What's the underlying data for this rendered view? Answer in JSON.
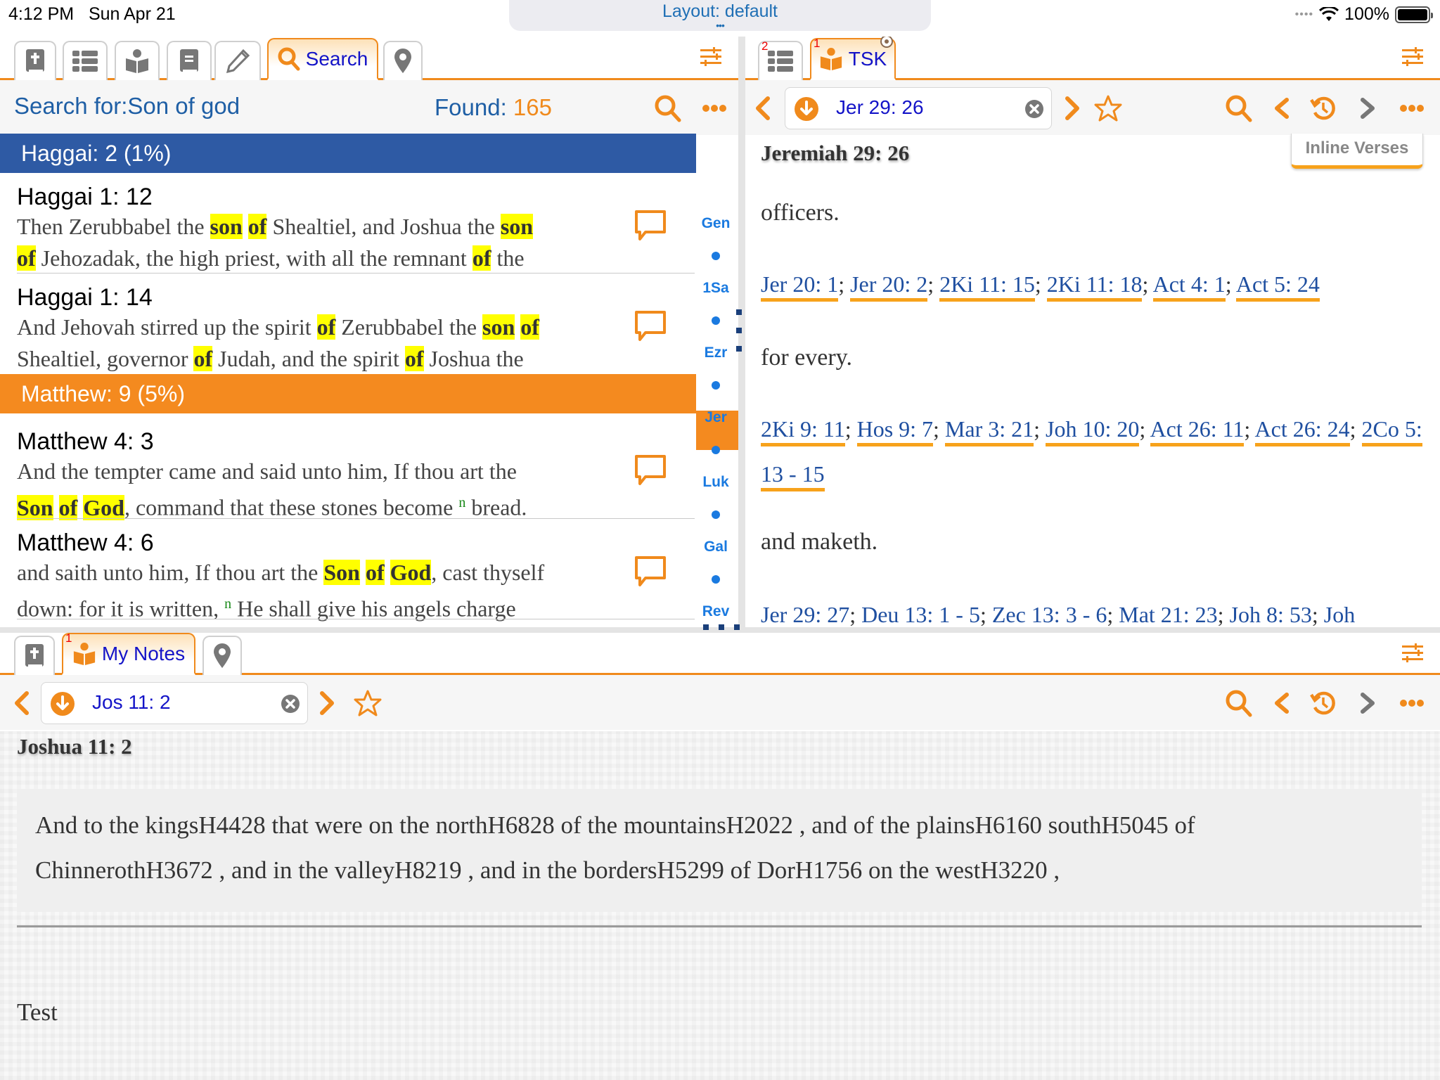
{
  "status_bar": {
    "time": "4:12 PM",
    "date": "Sun Apr 21",
    "battery": "100%",
    "battery_level": 1.0
  },
  "layout_pill": {
    "label": "Layout: default",
    "more": "•••"
  },
  "left_pane": {
    "tabs": [
      {
        "icon": "bible-icon",
        "label": ""
      },
      {
        "icon": "list-icon",
        "label": ""
      },
      {
        "icon": "reader-icon",
        "label": ""
      },
      {
        "icon": "book-icon",
        "label": ""
      },
      {
        "icon": "pencil-icon",
        "label": ""
      },
      {
        "icon": "search-icon",
        "label": "Search",
        "active": true
      },
      {
        "icon": "map-pin-icon",
        "label": ""
      }
    ],
    "search_for": "Search for:Son of god",
    "found_label": "Found:",
    "found_count": "165",
    "groups": [
      {
        "title": "Haggai: 2 (1%)",
        "color": "#2e5aa4",
        "items": [
          {
            "ref": "Haggai 1: 12",
            "line1": [
              "Then Zerubbabel the ",
              {
                "hl": "son"
              },
              " ",
              {
                "hl": "of"
              },
              " Shealtiel, and Joshua the ",
              {
                "hl": "son"
              }
            ],
            "line2": [
              {
                "hl": "of"
              },
              " Jehozadak, the high priest, with all the remnant ",
              {
                "hl": "of"
              },
              " the"
            ]
          },
          {
            "ref": "Haggai 1: 14",
            "line1": [
              "And Jehovah stirred up the spirit ",
              {
                "hl": "of"
              },
              " Zerubbabel the ",
              {
                "hl": "son"
              },
              " ",
              {
                "hl": "of"
              }
            ],
            "line2": [
              "Shealtiel, governor ",
              {
                "hl": "of"
              },
              " Judah, and the spirit ",
              {
                "hl": "of"
              },
              " Joshua the"
            ]
          }
        ]
      },
      {
        "title": "Matthew: 9 (5%)",
        "color": "#f48a1f",
        "items": [
          {
            "ref": "Matthew 4: 3",
            "line1": [
              "And the tempter came and said unto him, If thou art the"
            ],
            "line2": [
              {
                "hl": "Son"
              },
              " ",
              {
                "hl": "of"
              },
              " ",
              {
                "hl": "God"
              },
              ", command that these stones become ",
              {
                "sup": "n"
              },
              " bread."
            ]
          },
          {
            "ref": "Matthew 4: 6",
            "line1": [
              "and saith unto him, If thou art the ",
              {
                "hl": "Son"
              },
              " ",
              {
                "hl": "of"
              },
              " ",
              {
                "hl": "God"
              },
              ", cast thyself"
            ],
            "line2": [
              "down: for it is written, ",
              {
                "sup": "n"
              },
              " He shall give his angels charge"
            ]
          }
        ]
      }
    ],
    "book_index": [
      "Gen",
      "1Sa",
      "Ezr",
      "Jer",
      "Luk",
      "Gal",
      "Rev"
    ],
    "book_index_active": "Jer"
  },
  "right_pane": {
    "tabs": [
      {
        "icon": "list-icon",
        "label": "",
        "badge": "2"
      },
      {
        "icon": "reader-icon",
        "label": "TSK",
        "badge": "1",
        "active": true,
        "pinned": true
      }
    ],
    "reference": "Jer 29: 26",
    "title": "Jeremiah 29: 26",
    "inline_verses_label": "Inline Verses",
    "entries": [
      {
        "word": "officers.",
        "refs": [
          "Jer 20: 1",
          "Jer 20: 2",
          "2Ki 11: 15",
          "2Ki 11: 18",
          "Act 4: 1",
          "Act 5: 24"
        ]
      },
      {
        "word": "for every.",
        "refs": [
          "2Ki 9: 11",
          "Hos 9: 7",
          "Mar 3: 21",
          "Joh 10: 20",
          "Act 26: 11",
          "Act 26: 24",
          "2Co 5: 13 - 15"
        ]
      },
      {
        "word": "and maketh.",
        "refs": [
          "Jer 29: 27",
          "Deu 13: 1 - 5",
          "Zec 13: 3 - 6",
          "Mat 21: 23",
          "Joh 8: 53",
          "Joh"
        ]
      }
    ]
  },
  "bottom_pane": {
    "tabs": [
      {
        "icon": "bible-icon",
        "label": ""
      },
      {
        "icon": "reader-icon",
        "label": "My Notes",
        "badge": "1",
        "active": true
      },
      {
        "icon": "map-pin-icon",
        "label": ""
      }
    ],
    "reference": "Jos 11: 2",
    "title": "Joshua 11: 2",
    "verse_line1": "And to the kingsH4428 that were on the northH6828 of the mountainsH2022 , and of the plainsH6160 southH5045 of",
    "verse_line2": "ChinnerothH3672 , and in the valleyH8219 , and in the bordersH5299 of DorH1756 on the westH3220 ,",
    "note_text": "Test"
  },
  "colors": {
    "accent_orange": "#f08a1c",
    "link_blue": "#1f4fa0",
    "header_blue": "#2e5aa4",
    "highlight": "#ffff00",
    "index_blue": "#1a7ae0"
  }
}
